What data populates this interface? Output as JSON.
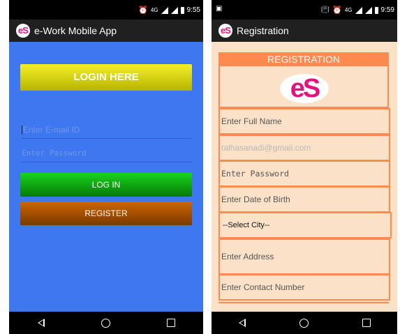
{
  "left_screen": {
    "status": {
      "network": "4G",
      "time": "9:55"
    },
    "appbar": {
      "logo": "eS",
      "title": "e-Work Mobile App"
    },
    "login_here_label": "LOGIN HERE",
    "email_placeholder": "Enter E-mail ID",
    "password_placeholder": "Enter Password",
    "login_label": "LOG IN",
    "register_label": "REGISTER"
  },
  "right_screen": {
    "status": {
      "network": "4G",
      "time": "9:59"
    },
    "appbar": {
      "logo": "eS",
      "title": "Registration"
    },
    "header": "REGISTRATION",
    "logo": "eS",
    "fields": {
      "full_name_placeholder": "Enter Full Name",
      "email_value": "talhasanadi@gmail.com",
      "password_placeholder": "Enter Password",
      "dob_placeholder": "Enter Date of Birth",
      "city_selected": "--Select City--",
      "address_placeholder": "Enter Address",
      "contact_placeholder": "Enter Contact Number"
    }
  },
  "colors": {
    "login_bg": "#3f77f0",
    "login_here_btn": "#e6e01a",
    "login_btn": "#10b813",
    "register_btn": "#b55500",
    "reg_bg": "#fbe1c7",
    "reg_accent": "#ff8a4f",
    "logo_pink": "#e5127d"
  },
  "icons": [
    "alarm-icon",
    "signal-icon",
    "battery-icon",
    "vibrate-icon",
    "image-notification-icon",
    "back-icon",
    "home-icon",
    "recents-icon"
  ]
}
